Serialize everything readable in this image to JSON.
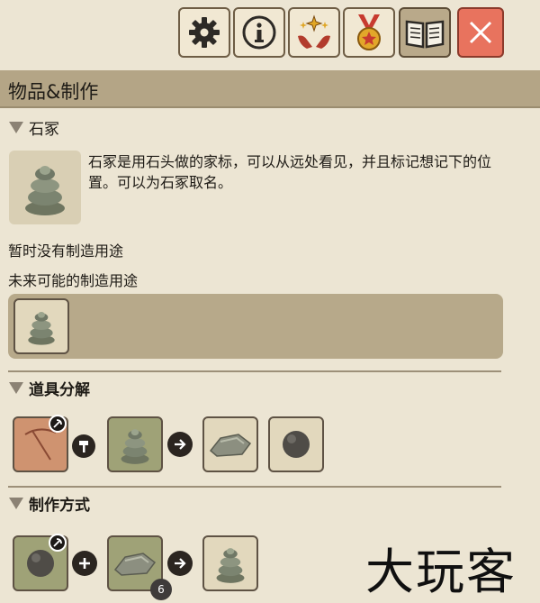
{
  "toolbar": {
    "buttons": [
      {
        "icon": "gear-icon"
      },
      {
        "icon": "info-icon"
      },
      {
        "icon": "sparkle-hands-icon"
      },
      {
        "icon": "medal-icon"
      },
      {
        "icon": "book-icon",
        "active": true
      },
      {
        "icon": "close-icon"
      }
    ]
  },
  "header": {
    "title": "物品&制作"
  },
  "item": {
    "name": "石冢",
    "description": "石冢是用石头做的家标，可以从远处看见，并且标记想记下的位置。可以为石冢取名。",
    "no_uses": "暂时没有制造用途",
    "future_uses_label": "未来可能的制造用途"
  },
  "sections": {
    "breakdown": "道具分解",
    "crafting": "制作方式"
  },
  "crafting": {
    "stone_quantity": "6"
  },
  "watermark": "大玩客",
  "colors": {
    "header_bg": "#b4a586",
    "page_bg": "#ece5d3",
    "close_bg": "#e8735e",
    "slot_green": "#9fa277",
    "slot_red": "#cf9370"
  }
}
